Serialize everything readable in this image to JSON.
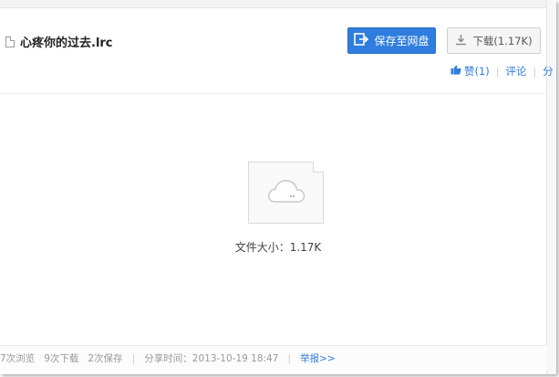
{
  "file": {
    "name": "心疼你的过去.lrc",
    "icon": "file-icon",
    "preview_icon": "cloud-icon",
    "size_text": "文件大小：1.17K"
  },
  "buttons": {
    "save_label": "保存至网盘",
    "save_icon": "save-to-cloud-icon",
    "download_label": "下载(1.17K)",
    "download_icon": "download-icon"
  },
  "actions": {
    "like_label": "赞(1)",
    "like_icon": "thumbs-up-icon",
    "comment_label": "评论",
    "share_label": "分"
  },
  "footer": {
    "views": "7次浏览",
    "downloads": "9次下载",
    "saves": "2次保存",
    "share_time": "分享时间：2013-10-19 18:47",
    "report": "举报>>"
  },
  "colors": {
    "accent": "#2f7dde",
    "muted_text": "#999999"
  }
}
